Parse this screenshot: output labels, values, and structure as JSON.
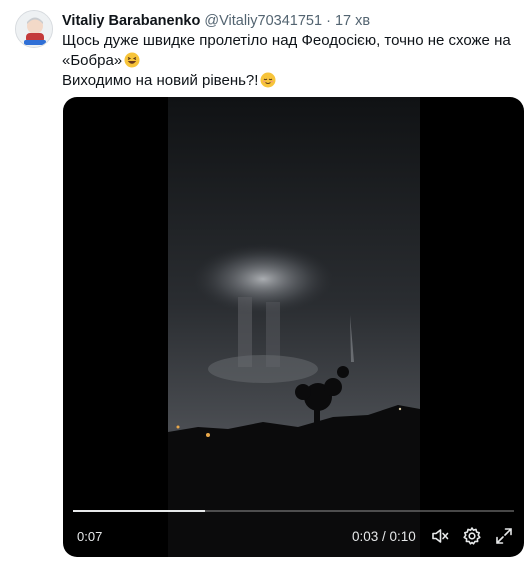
{
  "tweet": {
    "author_name": "Vitaliy Barabanenko",
    "handle": "@Vitaliy70341751",
    "separator": "·",
    "time": "17 хв",
    "text_line1": "Щось дуже швидке пролетіло над Феодосією, точно не схоже на",
    "text_line2": "«Бобра»",
    "text_line3": "Виходимо на новий рівень?!",
    "emoji1_name": "grinning-squinting-face",
    "emoji2_name": "relieved-face"
  },
  "video": {
    "elapsed_label": "0:07",
    "position_counter": "0:03 / 0:10",
    "progress_fraction": 0.3,
    "icons": [
      "mute-icon",
      "settings-gear-icon",
      "fullscreen-icon"
    ]
  }
}
